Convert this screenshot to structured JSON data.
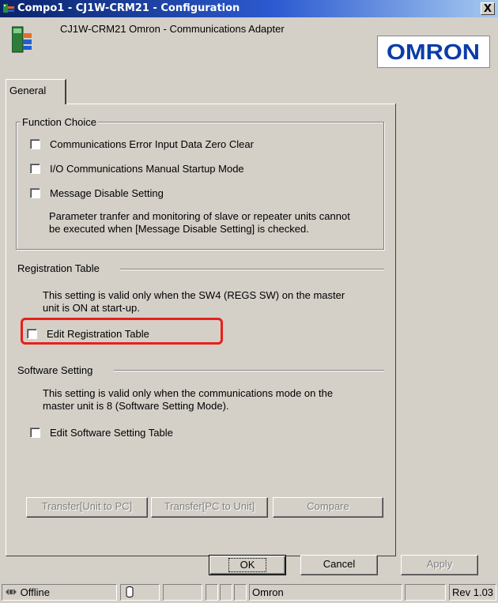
{
  "window": {
    "title": "Compo1 - CJ1W-CRM21 - Configuration",
    "close_label": "X"
  },
  "header": {
    "device_title": "CJ1W-CRM21  Omron - Communications Adapter",
    "logo_text": "OMRON",
    "logo_color": "#0a3ca8"
  },
  "tabs": [
    {
      "label": "General",
      "active": true
    }
  ],
  "function_choice": {
    "title": "Function Choice",
    "options": [
      {
        "label": "Communications Error Input Data Zero Clear",
        "checked": false
      },
      {
        "label": "I/O Communications Manual Startup Mode",
        "checked": false
      },
      {
        "label": "Message Disable Setting",
        "checked": false
      }
    ],
    "note_line1": "Parameter tranfer and monitoring of slave or repeater units cannot",
    "note_line2": "be executed when [Message Disable Setting] is checked."
  },
  "registration_table": {
    "title": "Registration Table",
    "note_line1": "This setting is valid only when the SW4 (REGS SW) on the master",
    "note_line2": "unit is ON at start-up.",
    "checkbox_label": "Edit Registration Table",
    "checked": false,
    "highlight_color": "#e8201c"
  },
  "software_setting": {
    "title": "Software Setting",
    "note_line1": "This setting is valid only when the communications mode on the",
    "note_line2": "master unit is 8 (Software Setting Mode).",
    "checkbox_label": "Edit Software Setting Table",
    "checked": false
  },
  "transfer_buttons": {
    "unit_to_pc": "Transfer[Unit to PC]",
    "pc_to_unit": "Transfer[PC to Unit]",
    "compare": "Compare"
  },
  "dialog_buttons": {
    "ok": "OK",
    "cancel": "Cancel",
    "apply": "Apply"
  },
  "statusbar": {
    "status": "Offline",
    "vendor": "Omron",
    "revision": "Rev 1.03"
  }
}
